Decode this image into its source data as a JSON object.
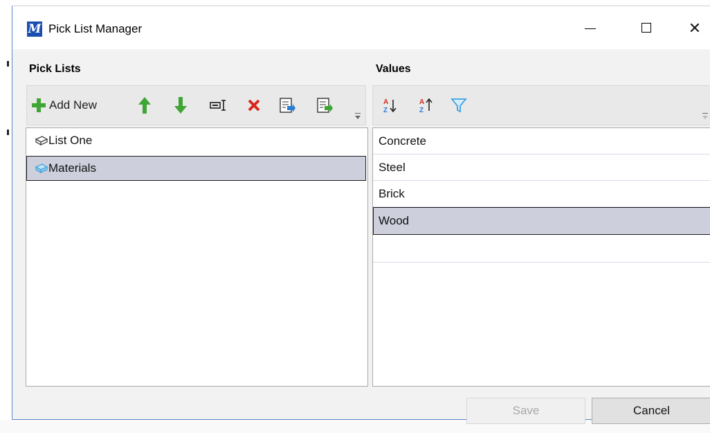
{
  "window": {
    "title": "Pick List Manager",
    "icon": "micro-app-icon"
  },
  "pick_lists": {
    "header": "Pick Lists",
    "toolbar": {
      "add_new_label": "Add New",
      "icons": [
        "plus-icon",
        "arrow-up-icon",
        "arrow-down-icon",
        "rename-icon",
        "delete-icon",
        "import-icon",
        "export-icon"
      ]
    },
    "items": [
      {
        "label": "List One",
        "selected": false
      },
      {
        "label": "Materials",
        "selected": true
      }
    ]
  },
  "values": {
    "header": "Values",
    "toolbar": {
      "icons": [
        "sort-ascending-icon",
        "sort-descending-icon",
        "filter-icon"
      ]
    },
    "items": [
      {
        "label": "Concrete",
        "selected": false
      },
      {
        "label": "Steel",
        "selected": false
      },
      {
        "label": "Brick",
        "selected": false
      },
      {
        "label": "Wood",
        "selected": true
      },
      {
        "label": "",
        "selected": false
      }
    ]
  },
  "buttons": {
    "save_label": "Save",
    "save_enabled": false,
    "cancel_label": "Cancel"
  },
  "colors": {
    "accent": "#1a4fb0",
    "selection": "#cdd0dc",
    "green": "#3fa535",
    "red": "#d9261c",
    "filter": "#3fa0e0"
  }
}
